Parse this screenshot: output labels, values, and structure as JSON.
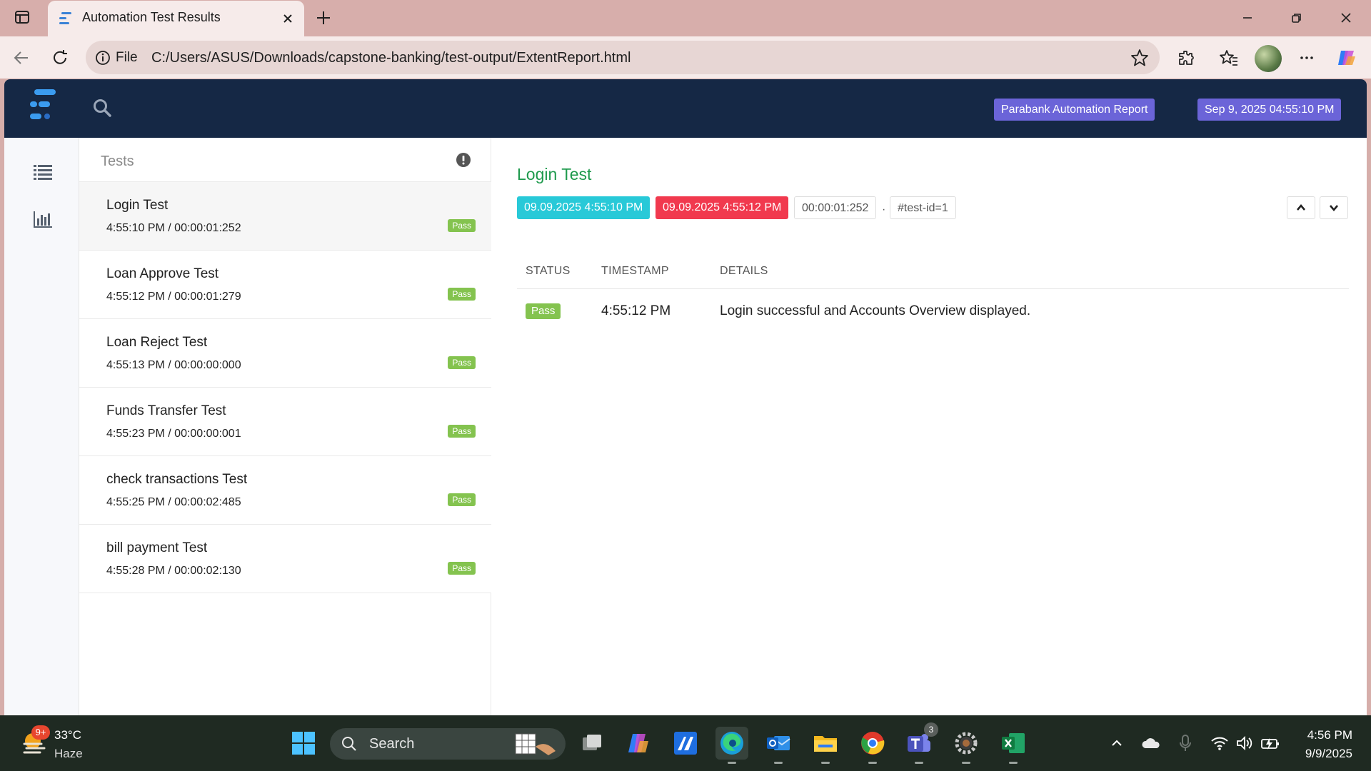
{
  "browser": {
    "tab_title": "Automation Test Results",
    "address_scheme": "File",
    "url": "C:/Users/ASUS/Downloads/capstone-banking/test-output/ExtentReport.html"
  },
  "report": {
    "header_badge": "Parabank Automation Report",
    "header_date": "Sep 9, 2025 04:55:10 PM",
    "tests_heading": "Tests",
    "tests": [
      {
        "name": "Login Test",
        "time": "4:55:10 PM / 00:00:01:252",
        "status": "Pass"
      },
      {
        "name": "Loan Approve Test",
        "time": "4:55:12 PM / 00:00:01:279",
        "status": "Pass"
      },
      {
        "name": "Loan Reject Test",
        "time": "4:55:13 PM / 00:00:00:000",
        "status": "Pass"
      },
      {
        "name": "Funds Transfer Test",
        "time": "4:55:23 PM / 00:00:00:001",
        "status": "Pass"
      },
      {
        "name": "check transactions Test",
        "time": "4:55:25 PM / 00:00:02:485",
        "status": "Pass"
      },
      {
        "name": "bill payment Test",
        "time": "4:55:28 PM / 00:00:02:130",
        "status": "Pass"
      }
    ],
    "detail": {
      "title": "Login Test",
      "start": "09.09.2025 4:55:10 PM",
      "end": "09.09.2025 4:55:12 PM",
      "duration": "00:00:01:252",
      "separator": "·",
      "test_id": "#test-id=1",
      "columns": [
        "STATUS",
        "TIMESTAMP",
        "DETAILS"
      ],
      "log": [
        {
          "status": "Pass",
          "timestamp": "4:55:12 PM",
          "details": "Login successful and Accounts Overview displayed."
        }
      ]
    }
  },
  "taskbar": {
    "weather_badge": "9+",
    "temperature": "33°C",
    "condition": "Haze",
    "search_label": "Search",
    "teams_badge": "3",
    "time": "4:56 PM",
    "date": "9/9/2025"
  },
  "colors": {
    "nav_bg": "#152845",
    "badge_purple": "#6b64d8",
    "pass_green": "#84c34f",
    "title_green": "#1f9a4d",
    "start_cyan": "#28c9d8",
    "end_red": "#f1394e"
  }
}
